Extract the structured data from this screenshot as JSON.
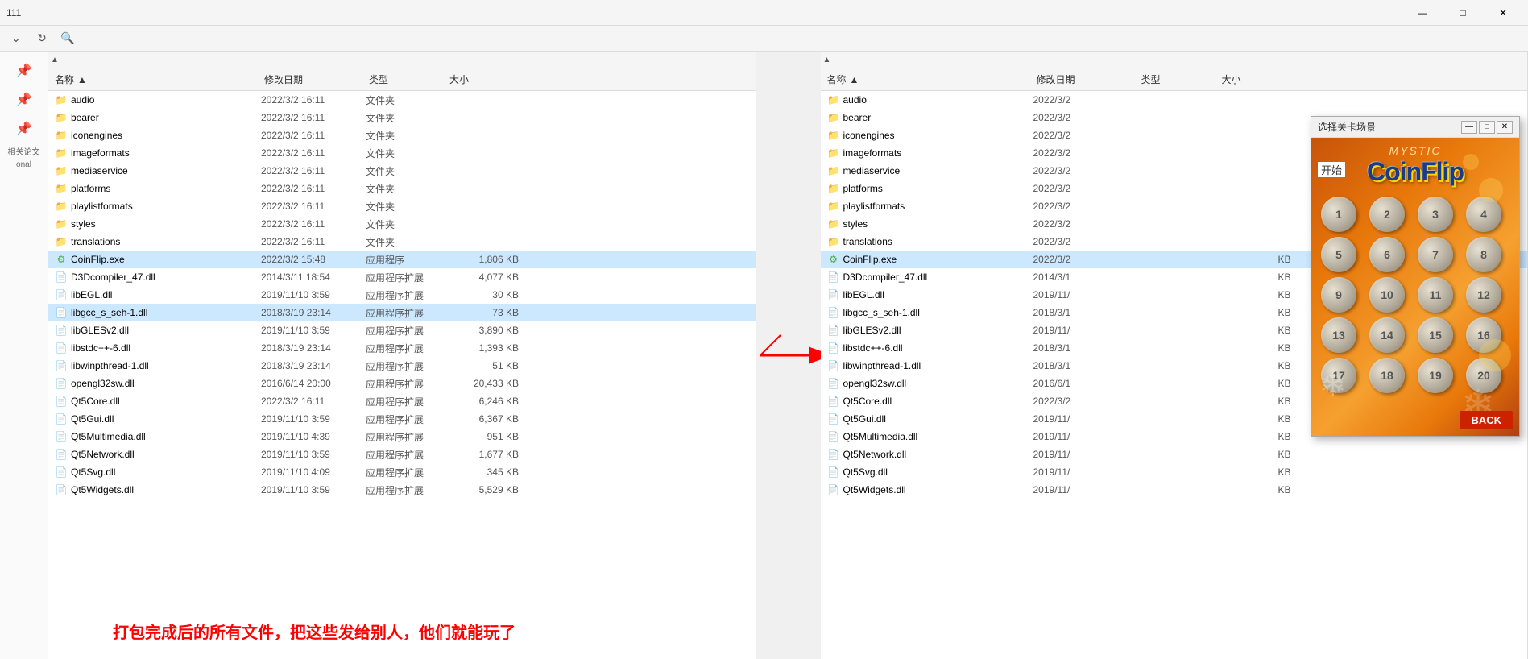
{
  "titlebar": {
    "title": "111",
    "min": "—",
    "max": "□",
    "close": "✕"
  },
  "address": {
    "placeholder": ""
  },
  "sidebar": {
    "items": [
      {
        "label": "固定",
        "icon": "📌"
      },
      {
        "label": "固定",
        "icon": "📌"
      },
      {
        "label": "固定",
        "icon": "📌"
      },
      {
        "label": "相关论文",
        "icon": "📄"
      },
      {
        "label": "onal",
        "icon": "📁"
      }
    ]
  },
  "left_panel": {
    "headers": {
      "name": "名称",
      "date": "修改日期",
      "type": "类型",
      "size": "大小"
    },
    "folders": [
      {
        "name": "audio",
        "date": "2022/3/2 16:11",
        "type": "文件夹",
        "size": ""
      },
      {
        "name": "bearer",
        "date": "2022/3/2 16:11",
        "type": "文件夹",
        "size": ""
      },
      {
        "name": "iconengines",
        "date": "2022/3/2 16:11",
        "type": "文件夹",
        "size": ""
      },
      {
        "name": "imageformats",
        "date": "2022/3/2 16:11",
        "type": "文件夹",
        "size": ""
      },
      {
        "name": "mediaservice",
        "date": "2022/3/2 16:11",
        "type": "文件夹",
        "size": ""
      },
      {
        "name": "platforms",
        "date": "2022/3/2 16:11",
        "type": "文件夹",
        "size": ""
      },
      {
        "name": "playlistformats",
        "date": "2022/3/2 16:11",
        "type": "文件夹",
        "size": ""
      },
      {
        "name": "styles",
        "date": "2022/3/2 16:11",
        "type": "文件夹",
        "size": ""
      },
      {
        "name": "translations",
        "date": "2022/3/2 16:11",
        "type": "文件夹",
        "size": ""
      }
    ],
    "files": [
      {
        "name": "CoinFlip.exe",
        "date": "2022/3/2 15:48",
        "type": "应用程序",
        "size": "1,806 KB",
        "selected": true,
        "icon": "exe"
      },
      {
        "name": "D3Dcompiler_47.dll",
        "date": "2014/3/11 18:54",
        "type": "应用程序扩展",
        "size": "4,077 KB",
        "selected": false,
        "icon": "dll"
      },
      {
        "name": "libEGL.dll",
        "date": "2019/11/10 3:59",
        "type": "应用程序扩展",
        "size": "30 KB",
        "selected": false,
        "icon": "dll"
      },
      {
        "name": "libgcc_s_seh-1.dll",
        "date": "2018/3/19 23:14",
        "type": "应用程序扩展",
        "size": "73 KB",
        "selected": true,
        "icon": "dll"
      },
      {
        "name": "libGLESv2.dll",
        "date": "2019/11/10 3:59",
        "type": "应用程序扩展",
        "size": "3,890 KB",
        "selected": false,
        "icon": "dll"
      },
      {
        "name": "libstdc++-6.dll",
        "date": "2018/3/19 23:14",
        "type": "应用程序扩展",
        "size": "1,393 KB",
        "selected": false,
        "icon": "dll"
      },
      {
        "name": "libwinpthread-1.dll",
        "date": "2018/3/19 23:14",
        "type": "应用程序扩展",
        "size": "51 KB",
        "selected": false,
        "icon": "dll"
      },
      {
        "name": "opengl32sw.dll",
        "date": "2016/6/14 20:00",
        "type": "应用程序扩展",
        "size": "20,433 KB",
        "selected": false,
        "icon": "dll"
      },
      {
        "name": "Qt5Core.dll",
        "date": "2022/3/2 16:11",
        "type": "应用程序扩展",
        "size": "6,246 KB",
        "selected": false,
        "icon": "dll"
      },
      {
        "name": "Qt5Gui.dll",
        "date": "2019/11/10 3:59",
        "type": "应用程序扩展",
        "size": "6,367 KB",
        "selected": false,
        "icon": "dll"
      },
      {
        "name": "Qt5Multimedia.dll",
        "date": "2019/11/10 4:39",
        "type": "应用程序扩展",
        "size": "951 KB",
        "selected": false,
        "icon": "dll"
      },
      {
        "name": "Qt5Network.dll",
        "date": "2019/11/10 3:59",
        "type": "应用程序扩展",
        "size": "1,677 KB",
        "selected": false,
        "icon": "dll"
      },
      {
        "name": "Qt5Svg.dll",
        "date": "2019/11/10 4:09",
        "type": "应用程序扩展",
        "size": "345 KB",
        "selected": false,
        "icon": "dll"
      },
      {
        "name": "Qt5Widgets.dll",
        "date": "2019/11/10 3:59",
        "type": "应用程序扩展",
        "size": "5,529 KB",
        "selected": false,
        "icon": "dll"
      }
    ]
  },
  "right_panel": {
    "headers": {
      "name": "名称",
      "date": "修改日期",
      "type": "类型",
      "size": "大小"
    },
    "folders": [
      {
        "name": "audio",
        "date": "2022/3/2",
        "type": "",
        "size": ""
      },
      {
        "name": "bearer",
        "date": "2022/3/2",
        "type": "",
        "size": ""
      },
      {
        "name": "iconengines",
        "date": "2022/3/2",
        "type": "",
        "size": ""
      },
      {
        "name": "imageformats",
        "date": "2022/3/2",
        "type": "",
        "size": ""
      },
      {
        "name": "mediaservice",
        "date": "2022/3/2",
        "type": "",
        "size": ""
      },
      {
        "name": "platforms",
        "date": "2022/3/2",
        "type": "",
        "size": ""
      },
      {
        "name": "playlistformats",
        "date": "2022/3/2",
        "type": "",
        "size": ""
      },
      {
        "name": "styles",
        "date": "2022/3/2",
        "type": "",
        "size": ""
      },
      {
        "name": "translations",
        "date": "2022/3/2",
        "type": "",
        "size": ""
      }
    ],
    "files": [
      {
        "name": "CoinFlip.exe",
        "date": "2022/3/2",
        "type": "",
        "size": "KB",
        "selected": true,
        "icon": "exe"
      },
      {
        "name": "D3Dcompiler_47.dll",
        "date": "2014/3/1",
        "type": "",
        "size": "KB",
        "selected": false,
        "icon": "dll"
      },
      {
        "name": "libEGL.dll",
        "date": "2019/11/",
        "type": "",
        "size": "KB",
        "selected": false,
        "icon": "dll"
      },
      {
        "name": "libgcc_s_seh-1.dll",
        "date": "2018/3/1",
        "type": "",
        "size": "KB",
        "selected": false,
        "icon": "dll"
      },
      {
        "name": "libGLESv2.dll",
        "date": "2019/11/",
        "type": "",
        "size": "KB",
        "selected": false,
        "icon": "dll"
      },
      {
        "name": "libstdc++-6.dll",
        "date": "2018/3/1",
        "type": "",
        "size": "KB",
        "selected": false,
        "icon": "dll"
      },
      {
        "name": "libwinpthread-1.dll",
        "date": "2018/3/1",
        "type": "",
        "size": "KB",
        "selected": false,
        "icon": "dll"
      },
      {
        "name": "opengl32sw.dll",
        "date": "2016/6/1",
        "type": "",
        "size": "KB",
        "selected": false,
        "icon": "dll"
      },
      {
        "name": "Qt5Core.dll",
        "date": "2022/3/2",
        "type": "",
        "size": "KB",
        "selected": false,
        "icon": "dll"
      },
      {
        "name": "Qt5Gui.dll",
        "date": "2019/11/",
        "type": "",
        "size": "KB",
        "selected": false,
        "icon": "dll"
      },
      {
        "name": "Qt5Multimedia.dll",
        "date": "2019/11/",
        "type": "",
        "size": "KB",
        "selected": false,
        "icon": "dll"
      },
      {
        "name": "Qt5Network.dll",
        "date": "2019/11/",
        "type": "",
        "size": "KB",
        "selected": false,
        "icon": "dll"
      },
      {
        "name": "Qt5Svg.dll",
        "date": "2019/11/",
        "type": "",
        "size": "KB",
        "selected": false,
        "icon": "dll"
      },
      {
        "name": "Qt5Widgets.dll",
        "date": "2019/11/",
        "type": "",
        "size": "KB",
        "selected": false,
        "icon": "dll"
      }
    ]
  },
  "dialog": {
    "title": "选择关卡场景",
    "start_label": "开始",
    "mystic": "MYSTIC",
    "game_name": "CoinFlip",
    "numbers": [
      1,
      2,
      3,
      4,
      5,
      6,
      7,
      8,
      9,
      10,
      11,
      12,
      13,
      14,
      15,
      16,
      17,
      18,
      19,
      20
    ],
    "back_btn": "BACK"
  },
  "bottom_text": "打包完成后的所有文件，把这些发给别人，他们就能玩了"
}
